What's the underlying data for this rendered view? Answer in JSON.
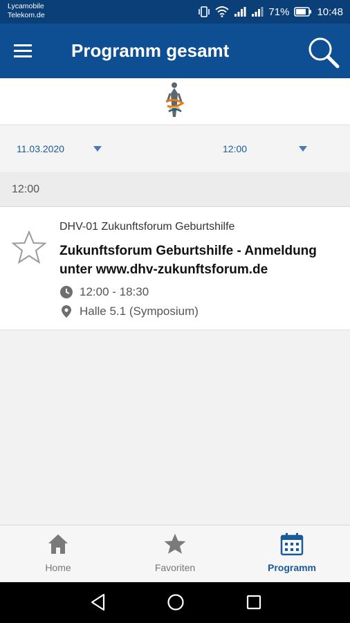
{
  "status": {
    "carrier_line1": "Lycamobile",
    "carrier_line2": "Telekom.de",
    "battery": "71%",
    "clock": "10:48"
  },
  "appbar": {
    "title": "Programm gesamt"
  },
  "filters": {
    "date": "11.03.2020",
    "time": "12:00"
  },
  "section": {
    "time": "12:00"
  },
  "session": {
    "code": "DHV-01 Zukunftsforum Geburtshilfe",
    "title": "Zukunftsforum Geburtshilfe - Anmeldung unter www.dhv-zukunftsforum.de",
    "time_range": "12:00 - 18:30",
    "location": "Halle 5.1 (Symposium)",
    "favorite": false
  },
  "bottom_nav": {
    "items": [
      {
        "label": "Home",
        "icon": "home-icon",
        "active": false
      },
      {
        "label": "Favoriten",
        "icon": "star-icon",
        "active": false
      },
      {
        "label": "Programm",
        "icon": "calendar-icon",
        "active": true
      }
    ]
  },
  "colors": {
    "status_bar": "#0b3f78",
    "app_bar": "#0d4f92",
    "accent": "#1a5a98",
    "inactive": "#777777"
  }
}
